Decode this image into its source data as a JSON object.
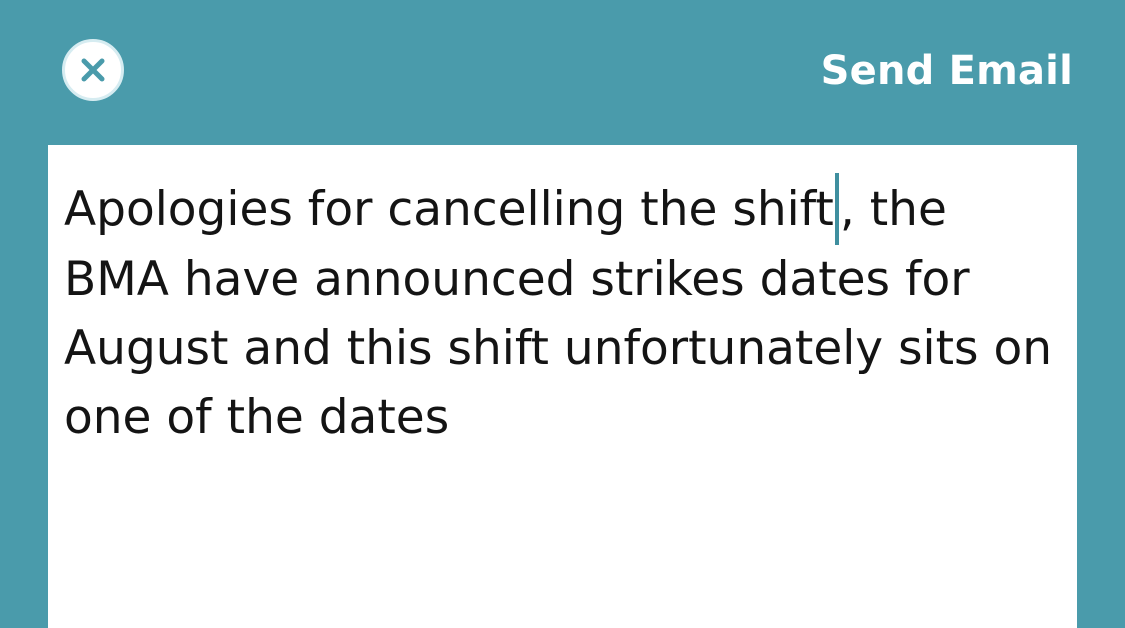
{
  "header": {
    "close_icon": "close-icon",
    "send_label": "Send Email"
  },
  "composer": {
    "text_before_caret": "Apologies for cancelling the shift",
    "text_after_caret": ", the BMA have announced strikes dates for August and this shift unfortunately sits on one of the dates"
  },
  "colors": {
    "header_background": "#4a9bab",
    "composer_background": "#ffffff",
    "caret": "#3f8f9f",
    "close_icon": "#4a9bab",
    "text": "#141414"
  }
}
